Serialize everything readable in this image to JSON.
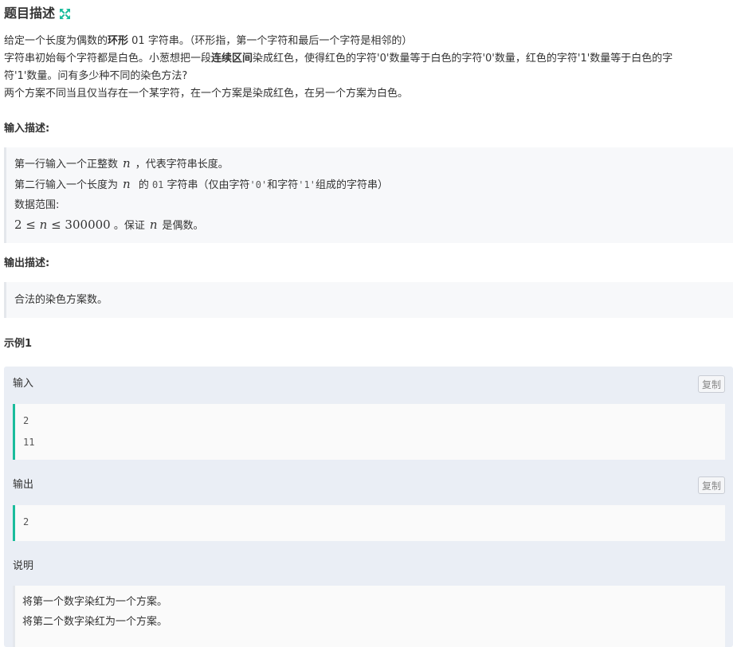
{
  "problem": {
    "title": "题目描述",
    "description": {
      "line1_pre": "给定一个长度为偶数的",
      "line1_bold": "环形",
      "line1_post": " 01 字符串。（环形指，第一个字符和最后一个字符是相邻的）",
      "line2_pre": "字符串初始每个字符都是白色。小葱想把一段",
      "line2_bold": "连续区间",
      "line2_post": "染成红色，使得红色的字符'0'数量等于白色的字符'0'数量，红色的字符'1'数量等于白色的字",
      "line3": "符'1'数量。问有多少种不同的染色方法?",
      "line4": "两个方案不同当且仅当存在一个某字符，在一个方案是染成红色，在另一个方案为白色。"
    }
  },
  "input_section": {
    "label": "输入描述:",
    "line1_pre": "第一行输入一个正整数",
    "line1_var": "n",
    "line1_post": "，代表字符串长度。",
    "line2_pre": "第二行输入一个长度为",
    "line2_var": "n",
    "line2_mid": " 的 ",
    "line2_code": "01",
    "line2_mid2": " 字符串（仅由字符",
    "line2_code0": "'0'",
    "line2_and": "和字符",
    "line2_code1": "'1'",
    "line2_post": "组成的字符串）",
    "line3": "数据范围:",
    "line4_math_a": "2 ≤ ",
    "line4_math_n": "n",
    "line4_math_b": " ≤ 300000",
    "line4_mid": "。保证",
    "line4_var": "n",
    "line4_post": "是偶数。"
  },
  "output_section": {
    "label": "输出描述:",
    "text": "合法的染色方案数。"
  },
  "example": {
    "title": "示例1",
    "input_label": "输入",
    "copy_label": "复制",
    "input_lines": [
      "2",
      "11"
    ],
    "output_label": "输出",
    "output_lines": [
      "2"
    ],
    "explain_label": "说明",
    "explain_lines": [
      "将第一个数字染红为一个方案。",
      "将第二个数字染红为一个方案。"
    ]
  },
  "colors": {
    "accent_green": "#1abc9c",
    "card_bg": "#eaeef5",
    "quote_bg": "#f7f8fa"
  },
  "icons": {
    "expand": "expand-arrows-icon"
  }
}
